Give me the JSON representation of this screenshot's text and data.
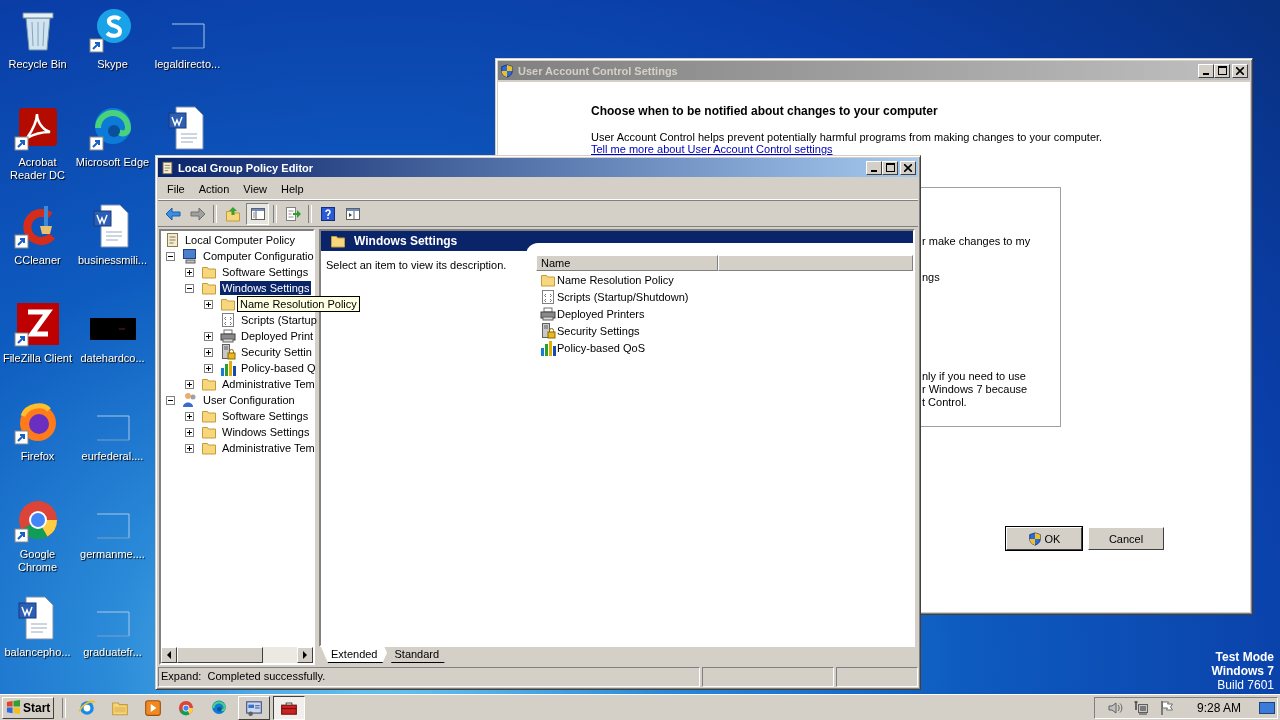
{
  "desktop_icons": [
    {
      "label": "Recycle Bin",
      "kind": "bin",
      "shortcut": false
    },
    {
      "label": "Acrobat Reader DC",
      "kind": "acrobat",
      "shortcut": true
    },
    {
      "label": "CCleaner",
      "kind": "ccleaner",
      "shortcut": true
    },
    {
      "label": "FileZilla Client",
      "kind": "filezilla",
      "shortcut": true
    },
    {
      "label": "Firefox",
      "kind": "firefox",
      "shortcut": true
    },
    {
      "label": "Google Chrome",
      "kind": "chrome",
      "shortcut": true
    },
    {
      "label": "balancepho...",
      "kind": "word",
      "shortcut": false
    },
    {
      "label": "Skype",
      "kind": "skype",
      "shortcut": true
    },
    {
      "label": "Microsoft Edge",
      "kind": "edge",
      "shortcut": true
    },
    {
      "label": "businessmili...",
      "kind": "word",
      "shortcut": false
    },
    {
      "label": "datehardco...",
      "kind": "dark-file",
      "shortcut": false
    },
    {
      "label": "eurfederal....",
      "kind": "blank-file",
      "shortcut": false
    },
    {
      "label": "germanme....",
      "kind": "blank-file",
      "shortcut": false
    },
    {
      "label": "graduatefr...",
      "kind": "blank-file",
      "shortcut": false
    },
    {
      "label": "legaldirecto...",
      "kind": "blank-file",
      "shortcut": false
    },
    {
      "kind": "word",
      "shortcut": false
    }
  ],
  "uac_window": {
    "title": "User Account Control Settings",
    "heading": "Choose when to be notified about changes to your computer",
    "description": "User Account Control helps prevent potentially harmful programs from making changes to your computer.",
    "link": "Tell me more about User Account Control settings",
    "box_fragments": [
      [
        "r make changes to my"
      ],
      [
        "ngs"
      ],
      [
        "nly if you need to use",
        "r Windows 7 because",
        "t Control."
      ]
    ],
    "buttons": [
      {
        "label": "OK",
        "kind": "shield",
        "default": true
      },
      {
        "label": "Cancel",
        "kind": "plain",
        "default": false
      }
    ]
  },
  "gpe_window": {
    "title": "Local Group Policy Editor",
    "menu": [
      "File",
      "Action",
      "View",
      "Help"
    ],
    "toolbar": [
      [
        {
          "kind": "back",
          "pressed": false
        },
        {
          "kind": "forward",
          "pressed": false
        }
      ],
      [
        {
          "kind": "up",
          "pressed": false
        },
        {
          "kind": "tree-toggle",
          "pressed": true
        }
      ],
      [
        {
          "kind": "export",
          "pressed": false
        }
      ],
      [
        {
          "kind": "help",
          "pressed": false
        },
        {
          "kind": "properties",
          "pressed": false
        }
      ]
    ],
    "tree": [
      {
        "label": "Local Computer Policy",
        "kind": "policy",
        "selected": false,
        "children": [
          {
            "label": "Computer Configuratio",
            "kind": "computer",
            "selected": false,
            "expanded": true,
            "children": [
              {
                "label": "Software Settings",
                "kind": "folder",
                "selected": false,
                "expanded": false
              },
              {
                "label": "Windows Settings",
                "kind": "folder",
                "selected": true,
                "expanded": true,
                "children": [
                  {
                    "tooltip": "Name Resolution Policy",
                    "kind": "folder",
                    "expanded": false
                  },
                  {
                    "label": "Scripts (Startup",
                    "kind": "script",
                    "selected": false
                  },
                  {
                    "label": "Deployed Print",
                    "kind": "printer",
                    "selected": false,
                    "expanded": false
                  },
                  {
                    "label": "Security Settin",
                    "kind": "security",
                    "selected": false,
                    "expanded": false
                  },
                  {
                    "label": "Policy-based Q",
                    "kind": "qos",
                    "selected": false,
                    "expanded": false
                  }
                ]
              },
              {
                "label": "Administrative Tem",
                "kind": "folder",
                "selected": false,
                "expanded": false
              }
            ]
          },
          {
            "label": "User Configuration",
            "kind": "user",
            "selected": false,
            "expanded": true,
            "children": [
              {
                "label": "Software Settings",
                "kind": "folder",
                "selected": false,
                "expanded": false
              },
              {
                "label": "Windows Settings",
                "kind": "folder",
                "selected": false,
                "expanded": false
              },
              {
                "label": "Administrative Tem",
                "kind": "folder",
                "selected": false,
                "expanded": false
              }
            ]
          }
        ]
      }
    ],
    "detail": {
      "header": "Windows Settings",
      "description": "Select an item to view its description.",
      "columns": [
        "Name"
      ],
      "items": [
        {
          "name": "Name Resolution Policy",
          "kind": "folder"
        },
        {
          "name": "Scripts (Startup/Shutdown)",
          "kind": "script"
        },
        {
          "name": "Deployed Printers",
          "kind": "printer"
        },
        {
          "name": "Security Settings",
          "kind": "security"
        },
        {
          "name": "Policy-based QoS",
          "kind": "qos"
        }
      ]
    },
    "tabs": [
      {
        "label": "Extended",
        "selected": true
      },
      {
        "label": "Standard",
        "selected": false
      }
    ],
    "status_bar": "Expand:  Completed successfully."
  },
  "test_mode_notice": [
    "Test Mode",
    "Windows 7",
    "Build 7601"
  ],
  "taskbar": {
    "start": "Start",
    "quick_launch": [
      {
        "kind": "ie"
      },
      {
        "kind": "explorer"
      },
      {
        "kind": "media-player"
      },
      {
        "kind": "chrome"
      },
      {
        "kind": "edge"
      }
    ],
    "tasks": [
      {
        "kind": "gpe-task",
        "selected": false
      },
      {
        "kind": "toolbox",
        "selected": true
      }
    ],
    "tray": [
      {
        "kind": "speaker"
      },
      {
        "kind": "network"
      },
      {
        "kind": "flag"
      }
    ],
    "clock": "9:28 AM"
  }
}
